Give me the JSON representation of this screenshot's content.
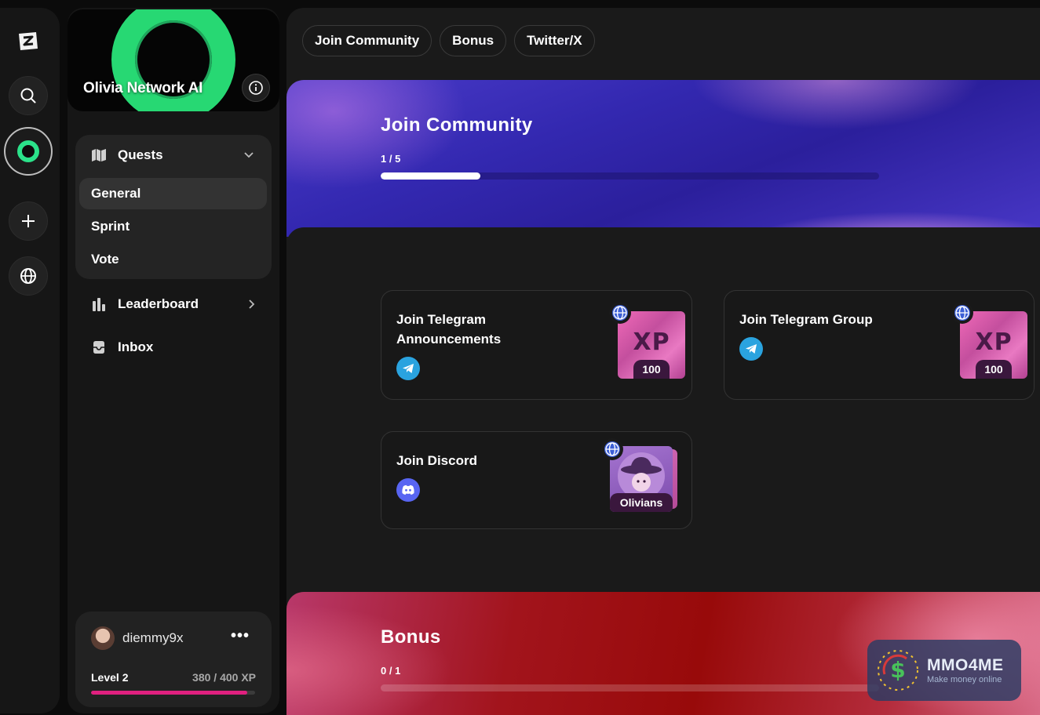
{
  "sidebar": {
    "project_name": "Olivia Network AI",
    "quests_label": "Quests",
    "sub_items": [
      "General",
      "Sprint",
      "Vote"
    ],
    "leaderboard_label": "Leaderboard",
    "inbox_label": "Inbox"
  },
  "user": {
    "name": "diemmy9x",
    "more": "•••",
    "level": "Level 2",
    "xp": "380 / 400 XP",
    "progress": 0.95
  },
  "tabs": [
    "Join Community",
    "Bonus",
    "Twitter/X"
  ],
  "sections": {
    "community": {
      "title": "Join Community",
      "count": "1 / 5",
      "progress": 0.2
    },
    "bonus": {
      "title": "Bonus",
      "count": "0 / 1",
      "progress": 0
    }
  },
  "quests": [
    {
      "title": "Join Telegram Announcements",
      "reward_label": "XP",
      "reward_amount": "100",
      "platform": "telegram-icon"
    },
    {
      "title": "Join Telegram Group",
      "reward_label": "XP",
      "reward_amount": "100",
      "platform": "telegram-icon"
    },
    {
      "title": "Join Discord",
      "reward_label": "Olivians",
      "platform": "discord-icon"
    }
  ],
  "watermark": {
    "name": "MMO4ME",
    "tagline": "Make money online"
  },
  "colors": {
    "accent_green": "#2be28a",
    "level_bar": "#e0207f",
    "telegram": "#2aa3df",
    "discord": "#5865f2"
  }
}
